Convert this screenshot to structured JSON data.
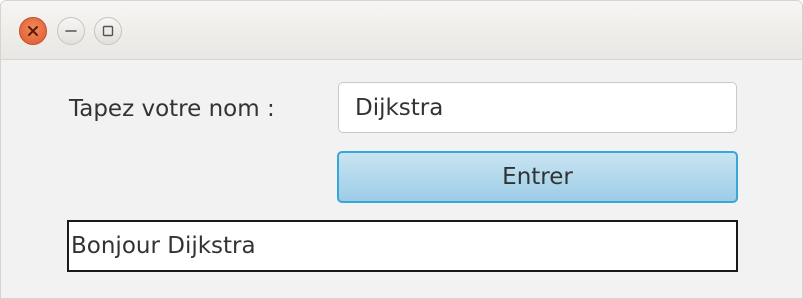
{
  "window": {
    "controls": {
      "close": "close-icon",
      "minimize": "minimize-icon",
      "maximize": "maximize-icon"
    }
  },
  "form": {
    "name_label": "Tapez votre nom :",
    "name_value": "Dijkstra",
    "enter_label": "Entrer",
    "output_text": "Bonjour Dijkstra"
  },
  "colors": {
    "close_button": "#e0582c",
    "button_focus_border": "#38a6d8",
    "button_fill": "#9ccde6"
  }
}
